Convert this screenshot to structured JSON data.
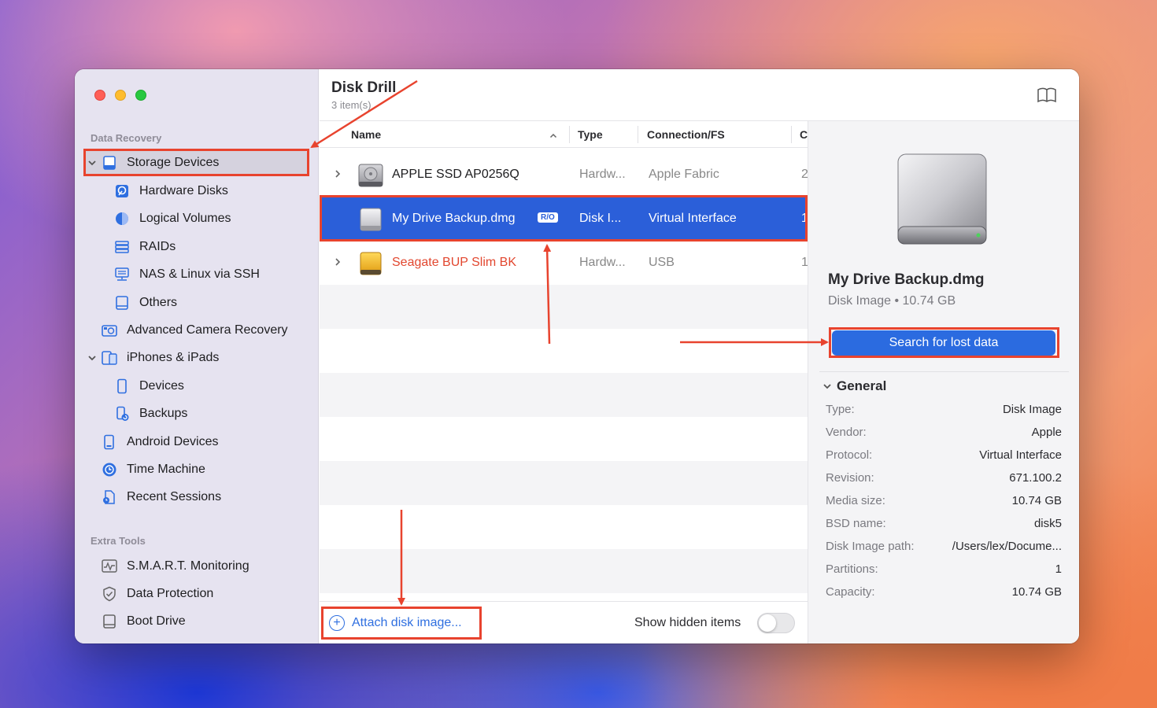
{
  "app": {
    "title": "Disk Drill",
    "subtitle": "3 item(s)"
  },
  "sidebar": {
    "sections": {
      "recovery": "Data Recovery",
      "tools": "Extra Tools"
    },
    "items": {
      "storage": "Storage Devices",
      "hardware": "Hardware Disks",
      "logical": "Logical Volumes",
      "raids": "RAIDs",
      "nas": "NAS & Linux via SSH",
      "others": "Others",
      "camera": "Advanced Camera Recovery",
      "iphones": "iPhones & iPads",
      "devices": "Devices",
      "backups": "Backups",
      "android": "Android Devices",
      "timemachine": "Time Machine",
      "recent": "Recent Sessions",
      "smart": "S.M.A.R.T. Monitoring",
      "protection": "Data Protection",
      "boot": "Boot Drive"
    }
  },
  "table": {
    "headers": {
      "name": "Name",
      "type": "Type",
      "conn": "Connection/FS",
      "cap": "C"
    },
    "rows": [
      {
        "name": "APPLE SSD AP0256Q",
        "type": "Hardw...",
        "conn": "Apple Fabric",
        "cap": "2"
      },
      {
        "name": "My Drive Backup.dmg",
        "badge": "R/O",
        "type": "Disk I...",
        "conn": "Virtual Interface",
        "cap": "1"
      },
      {
        "name": "Seagate BUP Slim BK",
        "type": "Hardw...",
        "conn": "USB",
        "cap": "1"
      }
    ]
  },
  "bottom": {
    "attach": "Attach disk image...",
    "hidden": "Show hidden items"
  },
  "details": {
    "name": "My Drive Backup.dmg",
    "sub": "Disk Image • 10.74 GB",
    "search": "Search for lost data",
    "general": "General",
    "props": [
      {
        "k": "Type:",
        "v": "Disk Image"
      },
      {
        "k": "Vendor:",
        "v": "Apple"
      },
      {
        "k": "Protocol:",
        "v": "Virtual Interface"
      },
      {
        "k": "Revision:",
        "v": "671.100.2"
      },
      {
        "k": "Media size:",
        "v": "10.74 GB"
      },
      {
        "k": "BSD name:",
        "v": "disk5"
      },
      {
        "k": "Disk Image path:",
        "v": "/Users/lex/Docume..."
      },
      {
        "k": "Partitions:",
        "v": "1"
      },
      {
        "k": "Capacity:",
        "v": "10.74 GB"
      }
    ]
  },
  "colors": {
    "accent": "#2b5fd9",
    "annotation": "#e8432e",
    "seagate": "#e2472f"
  }
}
